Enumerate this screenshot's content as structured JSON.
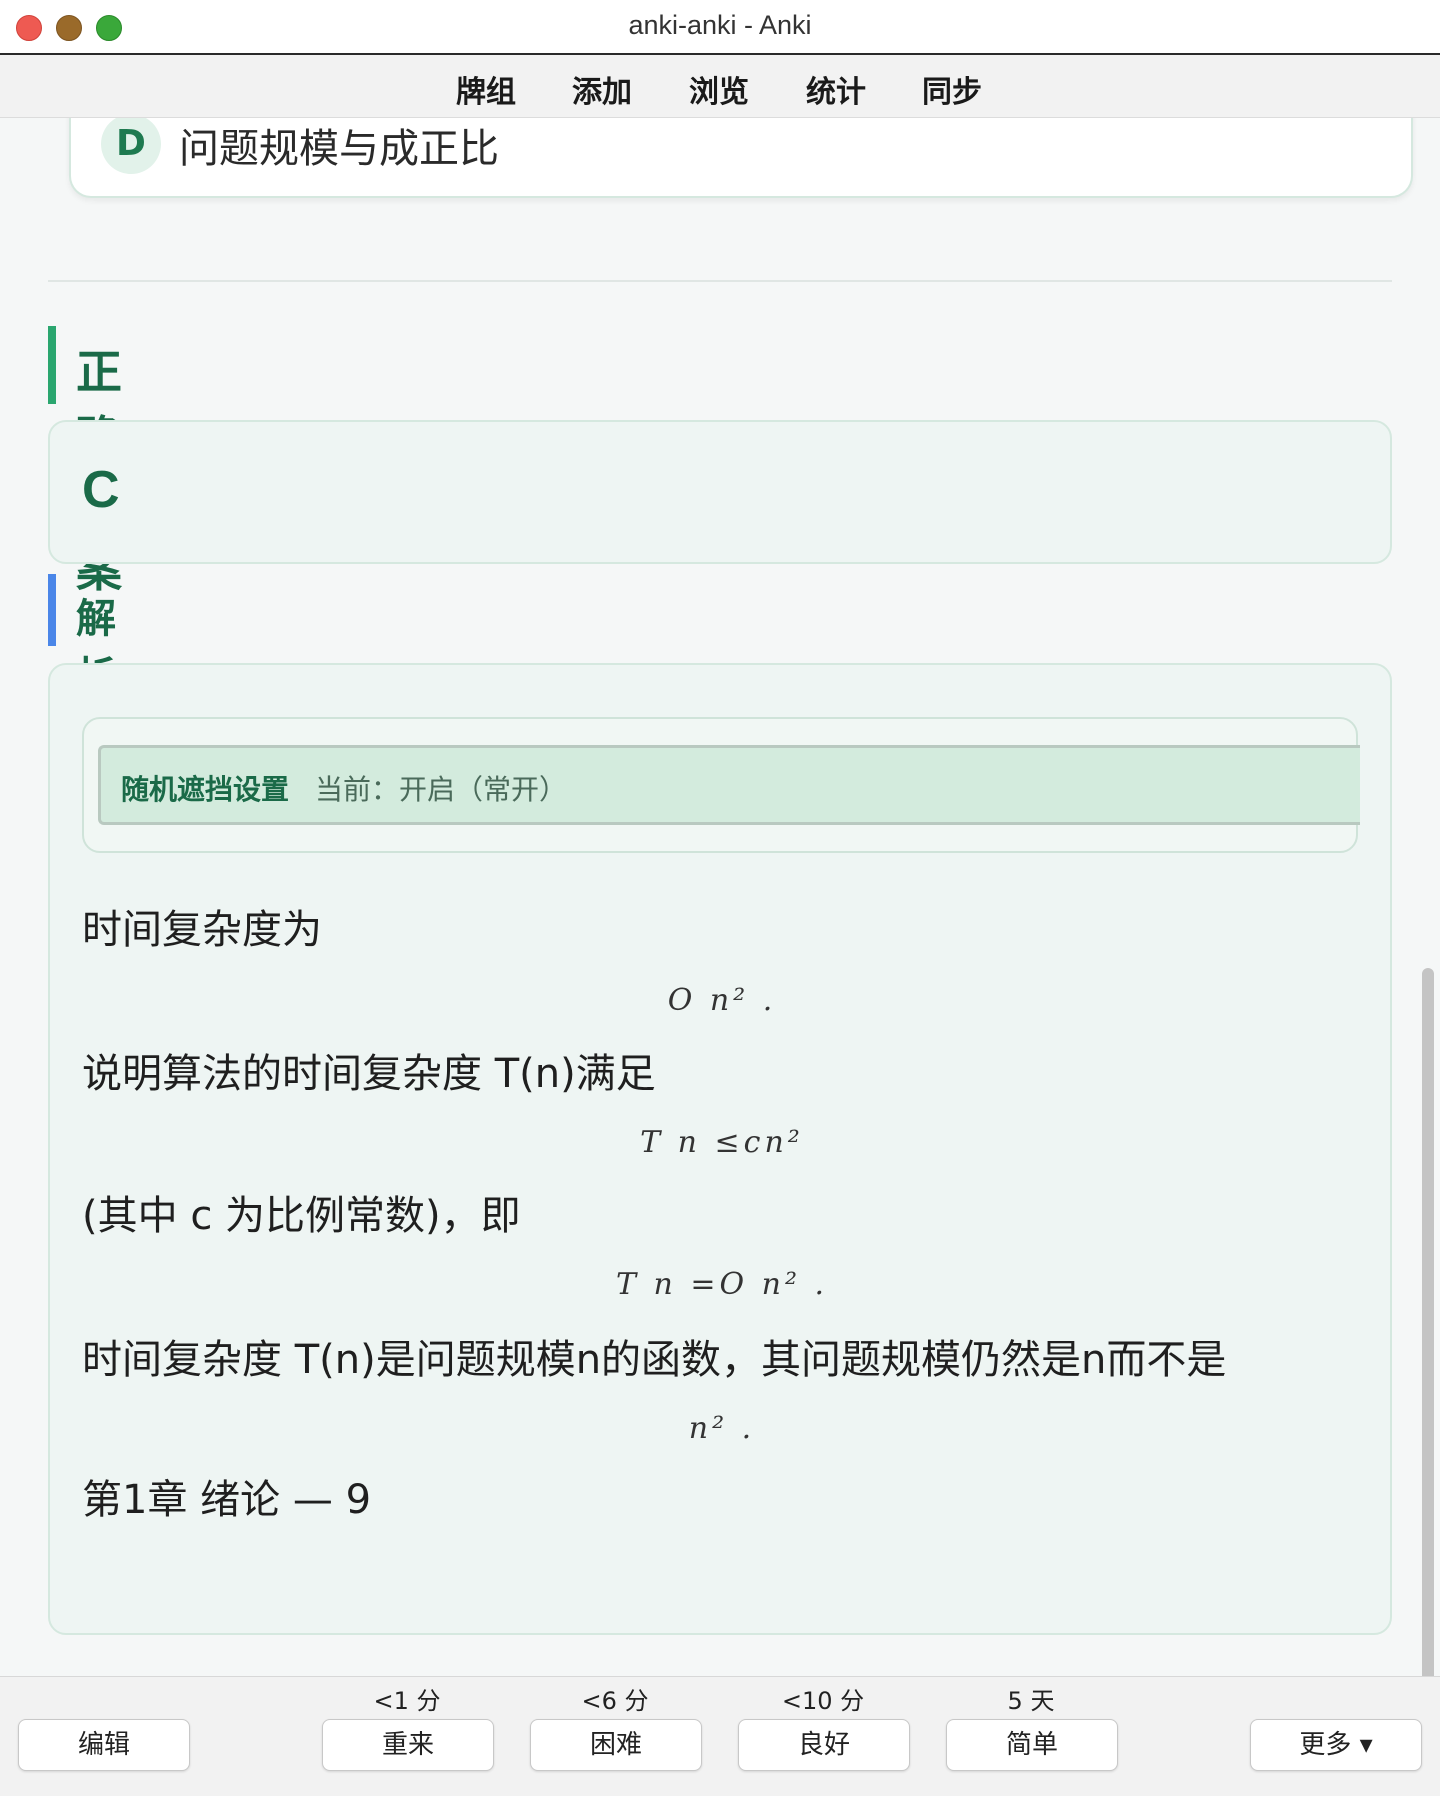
{
  "window": {
    "title": "anki-anki - Anki"
  },
  "toolbar": {
    "decks": "牌组",
    "add": "添加",
    "browse": "浏览",
    "stats": "统计",
    "sync": "同步"
  },
  "option": {
    "letter": "D",
    "text": "问题规模与成正比"
  },
  "correct_answer": {
    "heading": "正确答案",
    "value": "C"
  },
  "analysis": {
    "heading": "解析",
    "mask_label": "随机遮挡设置",
    "mask_status": "当前：开启（常开）",
    "para1": "时间复杂度为",
    "formula1": "O n² .",
    "para2": "说明算法的时间复杂度 T(n)满足",
    "formula2": "T n ≤cn²",
    "para3": "(其中 c 为比例常数)，即",
    "formula3": "T n =O n² .",
    "para4": "时间复杂度 T(n)是问题规模n的函数，其问题规模仍然是n而不是",
    "formula4": "n² .",
    "para5": "第1章 绪论 — 9"
  },
  "bottom": {
    "edit": "编辑",
    "again_interval": "<1 分",
    "again": "重来",
    "hard_interval": "<6 分",
    "hard": "困难",
    "good_interval": "<10 分",
    "good": "良好",
    "easy_interval": "5 天",
    "easy": "简单",
    "more": "更多 ▾"
  },
  "colors": {
    "accent_green": "#2aa66f",
    "accent_blue": "#4a86e8",
    "text_dark_green": "#1a6a48"
  }
}
